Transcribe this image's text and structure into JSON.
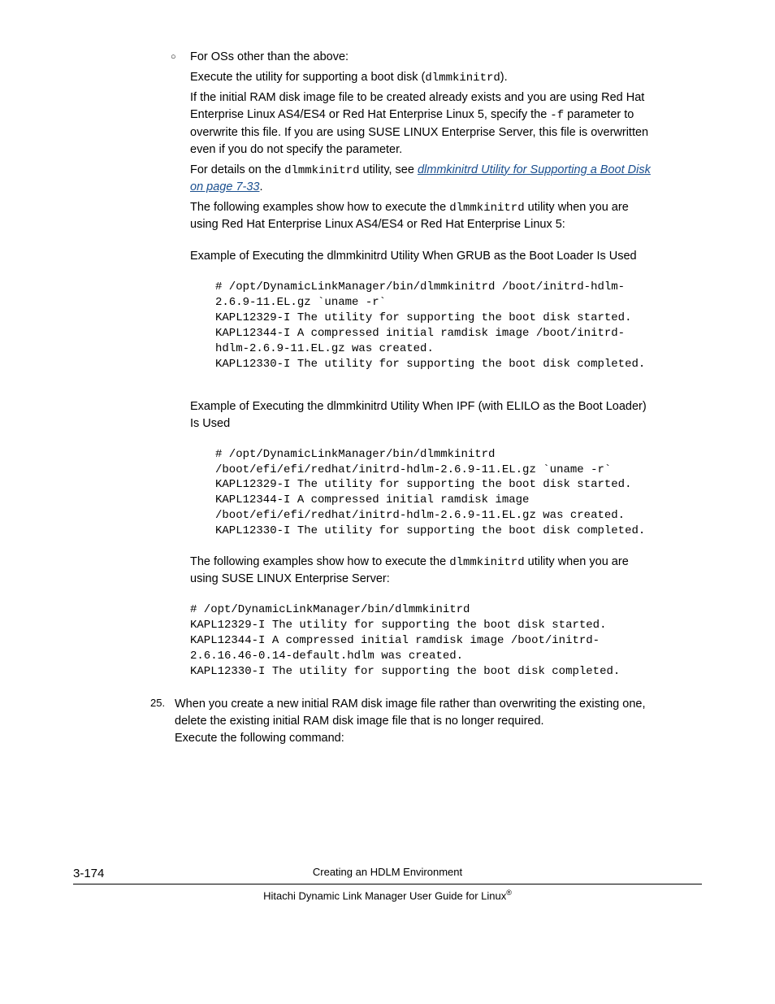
{
  "bullet1": {
    "marker": "○",
    "line1": "For OSs other than the above:",
    "line2_a": "Execute the utility for supporting a boot disk (",
    "line2_code": "dlmmkinitrd",
    "line2_b": ").",
    "line3_a": "If the initial RAM disk image file to be created already exists and you are using Red Hat Enterprise Linux AS4/ES4 or Red Hat Enterprise Linux 5, specify the ",
    "line3_code": "-f",
    "line3_b": " parameter to overwrite this file. If you are using SUSE LINUX Enterprise Server, this file is overwritten even if you do not specify the parameter.",
    "line4_a": "For details on the ",
    "line4_code": "dlmmkinitrd",
    "line4_b": " utility, see ",
    "line4_link": "dlmmkinitrd Utility for Supporting a Boot Disk on page 7-33",
    "line4_c": ".",
    "line5_a": "The following examples show how to execute the ",
    "line5_code": "dlmmkinitrd",
    "line5_b": " utility when you are using Red Hat Enterprise Linux AS4/ES4 or Red Hat Enterprise Linux 5:",
    "example1_title": "Example of Executing the dlmmkinitrd Utility When GRUB as the Boot Loader Is Used",
    "example1_code": "# /opt/DynamicLinkManager/bin/dlmmkinitrd /boot/initrd-hdlm-2.6.9-11.EL.gz `uname -r`\nKAPL12329-I The utility for supporting the boot disk started.\nKAPL12344-I A compressed initial ramdisk image /boot/initrd-hdlm-2.6.9-11.EL.gz was created.\nKAPL12330-I The utility for supporting the boot disk completed.",
    "example2_title": "Example of Executing the dlmmkinitrd Utility When IPF (with ELILO as the Boot Loader) Is Used",
    "example2_code": "# /opt/DynamicLinkManager/bin/dlmmkinitrd /boot/efi/efi/redhat/initrd-hdlm-2.6.9-11.EL.gz `uname -r`\nKAPL12329-I The utility for supporting the boot disk started.\nKAPL12344-I A compressed initial ramdisk image /boot/efi/efi/redhat/initrd-hdlm-2.6.9-11.EL.gz was created.\nKAPL12330-I The utility for supporting the boot disk completed.",
    "line6_a": "The following examples show how to execute the ",
    "line6_code": "dlmmkinitrd",
    "line6_b": " utility when you are using SUSE LINUX Enterprise Server:",
    "example3_code": "# /opt/DynamicLinkManager/bin/dlmmkinitrd\nKAPL12329-I The utility for supporting the boot disk started.\nKAPL12344-I A compressed initial ramdisk image /boot/initrd-2.6.16.46-0.14-default.hdlm was created.\nKAPL12330-I The utility for supporting the boot disk completed."
  },
  "item25": {
    "marker": "25.",
    "text1": "When you create a new initial RAM disk image file rather than overwriting the existing one, delete the existing initial RAM disk image file that is no longer required.",
    "text2": "Execute the following command:"
  },
  "footer": {
    "page": "3-174",
    "title": "Creating an HDLM Environment",
    "subtitle": "Hitachi Dynamic Link Manager User Guide for Linux",
    "reg": "®"
  }
}
